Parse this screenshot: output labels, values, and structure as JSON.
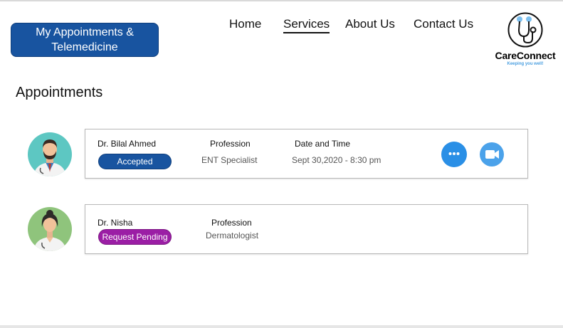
{
  "header": {
    "badge_title": "My Appointments & Telemedicine"
  },
  "nav": {
    "items": [
      {
        "label": "Home",
        "active": false
      },
      {
        "label": "Services",
        "active": true
      },
      {
        "label": "About Us",
        "active": false
      },
      {
        "label": "Contact Us",
        "active": false
      }
    ]
  },
  "logo": {
    "name": "CareConnect",
    "tagline": "Keeping you well!"
  },
  "page": {
    "title": "Appointments"
  },
  "appointments": [
    {
      "doctor": "Dr. Bilal Ahmed",
      "status": "Accepted",
      "profession_label": "Profession",
      "profession": "ENT Specialist",
      "datetime_label": "Date and Time",
      "datetime": "Sept 30,2020 - 8:30 pm",
      "actions": [
        "chat-icon",
        "video-icon"
      ]
    },
    {
      "doctor": "Dr. Nisha",
      "status": "Request Pending",
      "profession_label": "Profession",
      "profession": "Dermatologist"
    }
  ],
  "colors": {
    "brand_blue": "#1854a0",
    "pending_purple": "#9b1ea5",
    "action_blue": "#2a8fe6"
  }
}
